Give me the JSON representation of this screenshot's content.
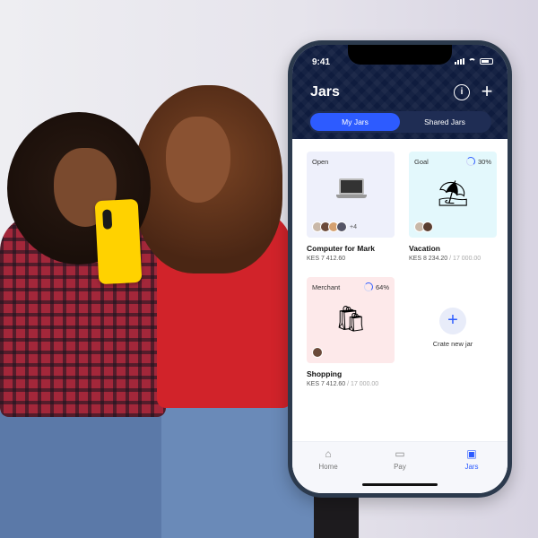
{
  "status_bar": {
    "time": "9:41"
  },
  "header": {
    "title": "Jars",
    "info_icon": "info-icon",
    "add_icon": "plus-icon"
  },
  "segmented": {
    "tabs": [
      {
        "label": "My Jars",
        "active": true
      },
      {
        "label": "Shared Jars",
        "active": false
      }
    ]
  },
  "jars": [
    {
      "tag": "Open",
      "name": "Computer for Mark",
      "amount": "KES 7 412.60",
      "goal": "",
      "progress": "",
      "extra_members": "+4",
      "tile_color": "#eef0fb",
      "art": "laptop-icon"
    },
    {
      "tag": "Goal",
      "name": "Vacation",
      "amount": "KES 8 234.20",
      "goal": "/ 17 000.00",
      "progress": "30%",
      "extra_members": "",
      "tile_color": "#e3f8fc",
      "art": "beach-umbrella-icon"
    },
    {
      "tag": "Merchant",
      "name": "Shopping",
      "amount": "KES 7 412.60",
      "goal": "/ 17 000.00",
      "progress": "64%",
      "extra_members": "",
      "tile_color": "#fde9ea",
      "art": "shopping-bags-icon"
    }
  ],
  "create": {
    "label": "Crate new jar"
  },
  "tabbar": {
    "items": [
      {
        "label": "Home",
        "icon": "home-icon"
      },
      {
        "label": "Pay",
        "icon": "card-icon"
      },
      {
        "label": "Jars",
        "icon": "jar-icon",
        "active": true
      }
    ]
  },
  "colors": {
    "accent": "#2d5bff",
    "header_bg": "#0f1c3e"
  }
}
